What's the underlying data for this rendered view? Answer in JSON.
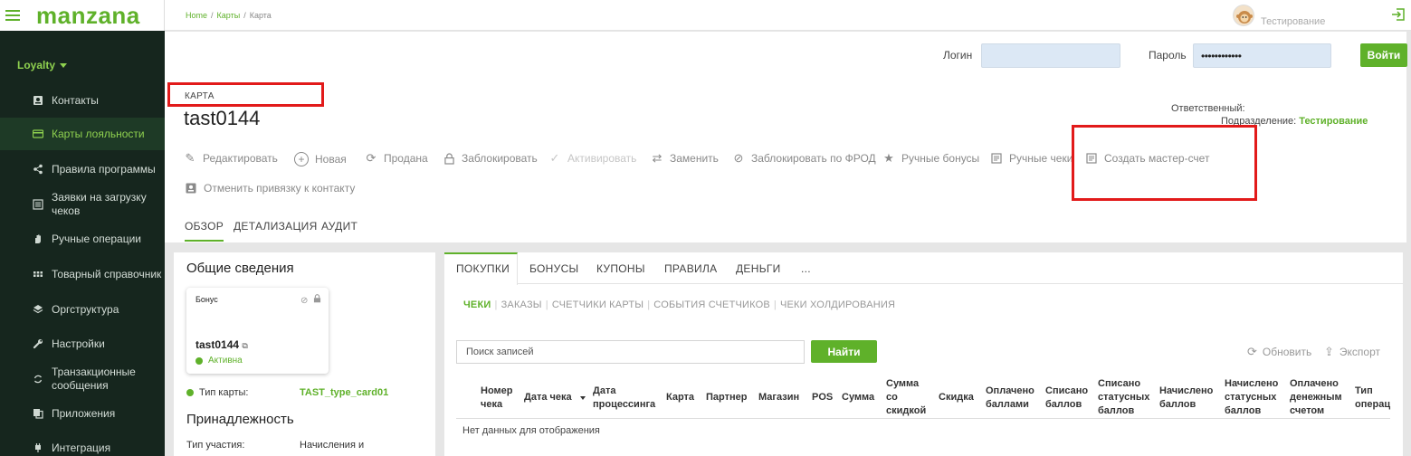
{
  "app": {
    "logo": "manzana"
  },
  "sidebar": {
    "section": "Loyalty",
    "items": [
      {
        "label": "Контакты",
        "icon": "contact-card-icon"
      },
      {
        "label": "Карты лояльности",
        "icon": "credit-card-icon"
      },
      {
        "label": "Правила программы",
        "icon": "share-nodes-icon"
      },
      {
        "label": "Заявки на загрузку чеков",
        "icon": "document-list-icon"
      },
      {
        "label": "Ручные операции",
        "icon": "hand-icon"
      },
      {
        "label": "Товарный справочник",
        "icon": "grid-icon"
      },
      {
        "label": "Оргструктура",
        "icon": "layers-icon"
      },
      {
        "label": "Настройки",
        "icon": "wrench-icon"
      },
      {
        "label": "Транзакционные сообщения",
        "icon": "sync-icon"
      },
      {
        "label": "Приложения",
        "icon": "copy-icon"
      },
      {
        "label": "Интеграция",
        "icon": "plug-icon"
      }
    ]
  },
  "header": {
    "breadcrumb": [
      "Home",
      "Карты",
      "Карта"
    ],
    "user_name": "Тестирование"
  },
  "auth": {
    "login_label": "Логин",
    "password_label": "Пароль",
    "password_value": "••••••••••••",
    "submit_label": "Войти"
  },
  "card": {
    "type_label": "КАРТА",
    "number": "tast0144",
    "responsible_label": "Ответственный:",
    "department_label": "Подразделение:",
    "department_value": "Тестирование"
  },
  "actions": [
    {
      "label": "Редактировать",
      "disabled": false
    },
    {
      "label": "Новая",
      "disabled": false
    },
    {
      "label": "Продана",
      "disabled": false
    },
    {
      "label": "Заблокировать",
      "disabled": false
    },
    {
      "label": "Активировать",
      "disabled": true
    },
    {
      "label": "Заменить",
      "disabled": false
    },
    {
      "label": "Заблокировать по ФРОД",
      "disabled": false
    },
    {
      "label": "Ручные бонусы",
      "disabled": false
    },
    {
      "label": "Ручные чеки",
      "disabled": false
    },
    {
      "label": "Создать мастер-счет",
      "disabled": false
    },
    {
      "label": "Отменить привязку к контакту",
      "disabled": false
    }
  ],
  "main_tabs": [
    "ОБЗОР",
    "ДЕТАЛИЗАЦИЯ",
    "АУДИТ"
  ],
  "info": {
    "title": "Общие сведения",
    "bonus_label": "Бонус",
    "bonus_number": "tast0144",
    "bonus_status": "Активна",
    "card_type_label": "Тип карты:",
    "card_type_value": "TAST_type_card01",
    "ownership_title": "Принадлежность",
    "participation_label": "Тип участия:",
    "participation_value": "Начисления и"
  },
  "right": {
    "tabs": [
      "ПОКУПКИ",
      "БОНУСЫ",
      "КУПОНЫ",
      "ПРАВИЛА",
      "ДЕНЬГИ",
      "..."
    ],
    "subtabs": [
      "ЧЕКИ",
      "ЗАКАЗЫ",
      "СЧЕТЧИКИ КАРТЫ",
      "СОБЫТИЯ СЧЕТЧИКОВ",
      "ЧЕКИ ХОЛДИРОВАНИЯ"
    ],
    "search_placeholder": "Поиск записей",
    "find_label": "Найти",
    "refresh_label": "Обновить",
    "export_label": "Экспорт",
    "columns": [
      [
        "Номер",
        "чека"
      ],
      [
        "Дата чека"
      ],
      [
        "Дата",
        "процессинга"
      ],
      [
        "Карта"
      ],
      [
        "Партнер"
      ],
      [
        "Магазин"
      ],
      [
        "POS"
      ],
      [
        "Сумма"
      ],
      [
        "Сумма",
        "со",
        "скидкой"
      ],
      [
        "Скидка"
      ],
      [
        "Оплачено",
        "баллами"
      ],
      [
        "Списано",
        "баллов"
      ],
      [
        "Списано",
        "статусных",
        "баллов"
      ],
      [
        "Начислено",
        "баллов"
      ],
      [
        "Начислено",
        "статусных",
        "баллов"
      ],
      [
        "Оплачено",
        "денежным",
        "счетом"
      ],
      [
        "Тип",
        "операц"
      ]
    ],
    "no_data": "Нет данных для отображения"
  },
  "colors": {
    "accent": "#5fb12a",
    "sidebar_bg": "#16261e",
    "highlight": "#e21a1a"
  }
}
